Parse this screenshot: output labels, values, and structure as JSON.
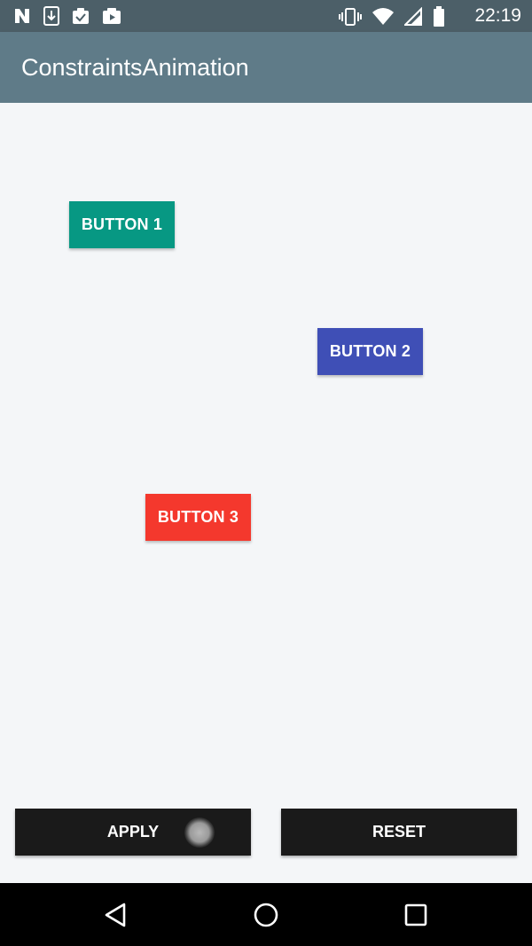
{
  "status_bar": {
    "time": "22:19",
    "left_icons": [
      "notification-n-icon",
      "download-icon",
      "clipboard-check-icon",
      "play-store-icon"
    ],
    "right_icons": [
      "vibrate-icon",
      "wifi-icon",
      "signal-icon",
      "battery-icon"
    ]
  },
  "app_bar": {
    "title": "ConstraintsAnimation"
  },
  "buttons": {
    "button1": "BUTTON 1",
    "button2": "BUTTON 2",
    "button3": "BUTTON 3"
  },
  "actions": {
    "apply": "APPLY",
    "reset": "RESET"
  },
  "nav_bar": {
    "icons": [
      "back-icon",
      "home-icon",
      "recents-icon"
    ]
  },
  "colors": {
    "status_bar": "#4c5f68",
    "app_bar": "#5f7b88",
    "button1": "#079883",
    "button2": "#3f4fb6",
    "button3": "#f4382d",
    "action_buttons": "#1a1a1a"
  }
}
